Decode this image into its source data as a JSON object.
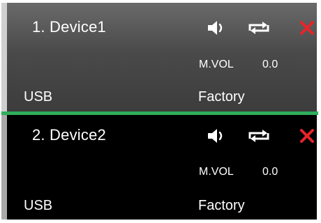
{
  "devices": [
    {
      "title": "1. Device1",
      "icons": {
        "speaker": "speaker-icon",
        "loop": "loop-icon",
        "close": "close-icon"
      },
      "mvol_label": "M.VOL",
      "mvol_value": "0.0",
      "source": "USB",
      "preset": "Factory",
      "selected": true
    },
    {
      "title": "2. Device2",
      "icons": {
        "speaker": "speaker-icon",
        "loop": "loop-icon",
        "close": "close-icon"
      },
      "mvol_label": "M.VOL",
      "mvol_value": "0.0",
      "source": "USB",
      "preset": "Factory",
      "selected": false
    }
  ],
  "colors": {
    "selected_bg": "#4a4a4a",
    "normal_bg": "#000000",
    "close_red": "#e8242a",
    "separator_green": "#2fae5a",
    "text": "#ffffff"
  }
}
